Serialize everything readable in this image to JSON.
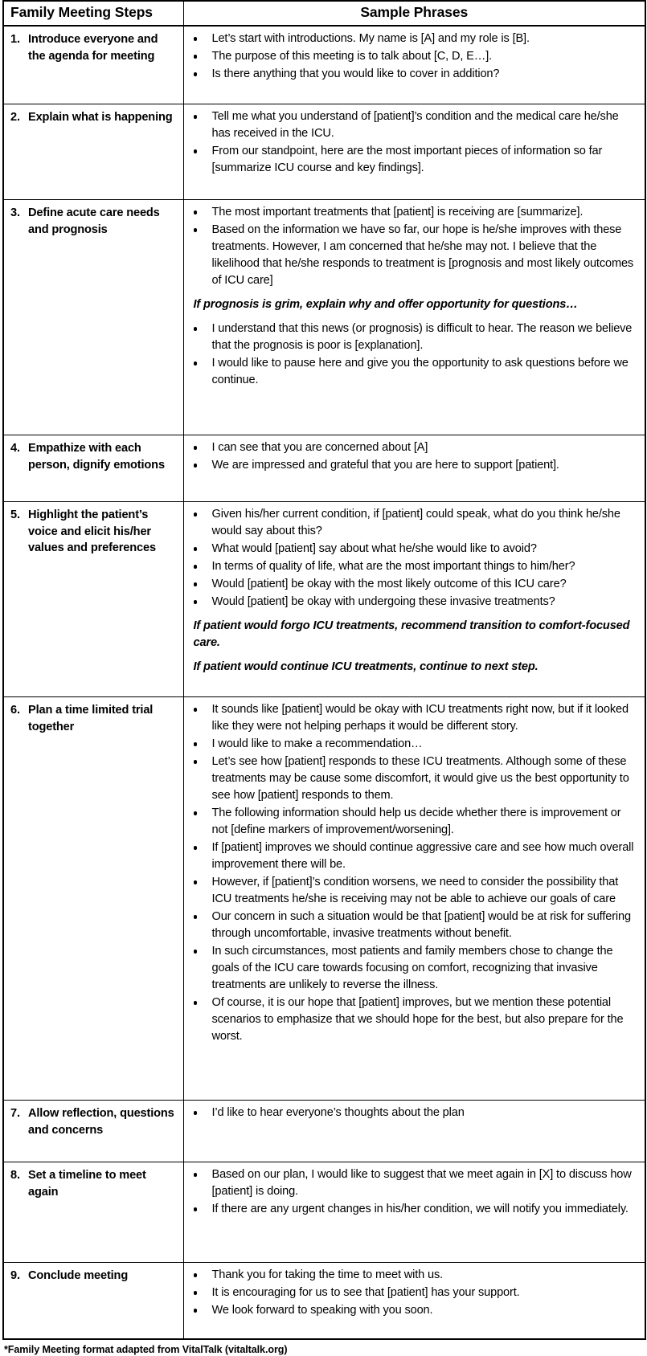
{
  "table": {
    "headers": {
      "steps": "Family Meeting Steps",
      "phrases": "Sample Phrases"
    },
    "rows": [
      {
        "number": "1.",
        "step": "Introduce everyone and the agenda for meeting",
        "blocks": [
          {
            "type": "bullets",
            "items": [
              "Let’s start with introductions.  My name is [A] and my role is [B].",
              "The purpose of this meeting is to talk about [C, D, E…].",
              "Is there anything that you would like to cover in addition?"
            ]
          }
        ]
      },
      {
        "number": "2.",
        "step": "Explain what is happening",
        "blocks": [
          {
            "type": "bullets",
            "items": [
              "Tell me what you understand of [patient]’s condition and the medical care he/she has received in the ICU.",
              "From our standpoint, here are the most important pieces of information so far [summarize ICU course and key findings]."
            ]
          }
        ]
      },
      {
        "number": "3.",
        "step": "Define acute care needs and prognosis",
        "blocks": [
          {
            "type": "bullets",
            "items": [
              "The most important treatments that [patient] is receiving are [summarize].",
              "Based on the information we have so far, our hope is he/she improves with these treatments.  However, I am concerned that he/she may not. I believe that the likelihood that he/she responds to treatment is [prognosis and most likely outcomes of ICU care]"
            ]
          },
          {
            "type": "note",
            "text": "If prognosis is grim, explain why and offer opportunity for questions…"
          },
          {
            "type": "bullets",
            "items": [
              "I understand that this news (or prognosis) is difficult to hear.  The reason we believe that the prognosis is poor is [explanation].",
              "I would like to pause here and give you the opportunity to ask questions before we continue."
            ]
          }
        ]
      },
      {
        "number": "4.",
        "step": "Empathize with each person, dignify emotions",
        "blocks": [
          {
            "type": "bullets",
            "items": [
              "I can see that you are concerned about [A]",
              "We are impressed and grateful that you are here to support [patient]."
            ]
          }
        ]
      },
      {
        "number": "5.",
        "step": "Highlight the patient’s voice and elicit his/her values and preferences",
        "blocks": [
          {
            "type": "bullets",
            "items": [
              "Given his/her current condition, if [patient] could speak, what do you think he/she would say about this?",
              "What would [patient] say about what he/she would like to avoid?",
              "In terms of quality of life, what are the most important things to him/her?",
              "Would [patient] be okay with the most likely outcome of this ICU care?",
              "Would [patient] be okay with undergoing these invasive treatments?"
            ]
          },
          {
            "type": "note",
            "text": "If patient would forgo ICU treatments, recommend transition to comfort-focused care."
          },
          {
            "type": "note",
            "text": "If patient would continue ICU treatments, continue to next step."
          }
        ]
      },
      {
        "number": "6.",
        "step": "Plan a time limited trial together",
        "blocks": [
          {
            "type": "bullets",
            "items": [
              "It sounds like [patient] would be okay with ICU treatments right now, but if it looked like they were not helping perhaps it would be different story.",
              "I would like to make a recommendation…",
              "Let’s see how [patient] responds to these ICU treatments.  Although some of these treatments may be cause some discomfort, it would give us the best opportunity to see how [patient] responds to them.",
              "The following information should help us decide whether there is improvement or not [define markers of improvement/worsening].",
              "If [patient] improves we should continue aggressive care and see how much overall improvement there will be.",
              "However, if [patient]’s condition worsens, we need to consider the possibility that ICU treatments he/she is receiving may not be able to achieve our goals of care",
              "Our concern in such a situation would be that [patient] would be at risk for suffering through uncomfortable, invasive treatments without benefit.",
              "In such circumstances, most patients and family members chose to change the goals of the ICU care towards focusing on comfort, recognizing that invasive treatments are unlikely to reverse the illness.",
              "Of course, it is our hope that [patient] improves, but we mention these potential scenarios to emphasize that we should hope for the best, but also prepare for the worst."
            ]
          }
        ]
      },
      {
        "number": "7.",
        "step": "Allow reflection, questions and concerns",
        "blocks": [
          {
            "type": "bullets",
            "items": [
              "I’d like to hear everyone’s thoughts about the plan"
            ]
          }
        ]
      },
      {
        "number": "8.",
        "step": "Set a timeline to meet again",
        "blocks": [
          {
            "type": "bullets",
            "items": [
              "Based on our plan, I would like to suggest that we meet again in [X] to discuss how [patient] is doing.",
              "If there are any urgent changes in his/her condition, we will notify you immediately."
            ]
          }
        ]
      },
      {
        "number": "9.",
        "step": "Conclude meeting",
        "blocks": [
          {
            "type": "bullets",
            "items": [
              "Thank you for taking the time to meet with us.",
              "It is encouraging for us to see that [patient] has your support.",
              "We look forward to speaking with you soon."
            ]
          }
        ]
      }
    ],
    "row_min_heights": [
      82,
      104,
      278,
      68,
      228,
      487,
      62,
      110,
      80
    ]
  },
  "footnote": "*Family Meeting format adapted from VitalTalk (vitaltalk.org)"
}
